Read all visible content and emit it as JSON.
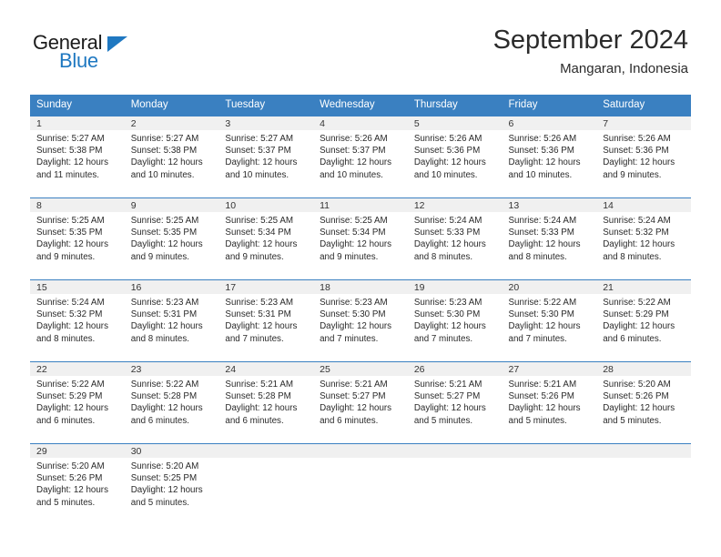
{
  "logo": {
    "primary_text": "General",
    "secondary_text": "Blue",
    "triangle_color": "#1f78c1"
  },
  "header": {
    "title": "September 2024",
    "subtitle": "Mangaran, Indonesia"
  },
  "theme": {
    "header_blue": "#3a80c1",
    "daynum_band": "#f0f0f0",
    "text": "#2a2a2a"
  },
  "calendar": {
    "weekday_headers": [
      "Sunday",
      "Monday",
      "Tuesday",
      "Wednesday",
      "Thursday",
      "Friday",
      "Saturday"
    ],
    "weeks": [
      [
        {
          "day": "1",
          "sunrise": "Sunrise: 5:27 AM",
          "sunset": "Sunset: 5:38 PM",
          "daylight_1": "Daylight: 12 hours",
          "daylight_2": "and 11 minutes."
        },
        {
          "day": "2",
          "sunrise": "Sunrise: 5:27 AM",
          "sunset": "Sunset: 5:38 PM",
          "daylight_1": "Daylight: 12 hours",
          "daylight_2": "and 10 minutes."
        },
        {
          "day": "3",
          "sunrise": "Sunrise: 5:27 AM",
          "sunset": "Sunset: 5:37 PM",
          "daylight_1": "Daylight: 12 hours",
          "daylight_2": "and 10 minutes."
        },
        {
          "day": "4",
          "sunrise": "Sunrise: 5:26 AM",
          "sunset": "Sunset: 5:37 PM",
          "daylight_1": "Daylight: 12 hours",
          "daylight_2": "and 10 minutes."
        },
        {
          "day": "5",
          "sunrise": "Sunrise: 5:26 AM",
          "sunset": "Sunset: 5:36 PM",
          "daylight_1": "Daylight: 12 hours",
          "daylight_2": "and 10 minutes."
        },
        {
          "day": "6",
          "sunrise": "Sunrise: 5:26 AM",
          "sunset": "Sunset: 5:36 PM",
          "daylight_1": "Daylight: 12 hours",
          "daylight_2": "and 10 minutes."
        },
        {
          "day": "7",
          "sunrise": "Sunrise: 5:26 AM",
          "sunset": "Sunset: 5:36 PM",
          "daylight_1": "Daylight: 12 hours",
          "daylight_2": "and 9 minutes."
        }
      ],
      [
        {
          "day": "8",
          "sunrise": "Sunrise: 5:25 AM",
          "sunset": "Sunset: 5:35 PM",
          "daylight_1": "Daylight: 12 hours",
          "daylight_2": "and 9 minutes."
        },
        {
          "day": "9",
          "sunrise": "Sunrise: 5:25 AM",
          "sunset": "Sunset: 5:35 PM",
          "daylight_1": "Daylight: 12 hours",
          "daylight_2": "and 9 minutes."
        },
        {
          "day": "10",
          "sunrise": "Sunrise: 5:25 AM",
          "sunset": "Sunset: 5:34 PM",
          "daylight_1": "Daylight: 12 hours",
          "daylight_2": "and 9 minutes."
        },
        {
          "day": "11",
          "sunrise": "Sunrise: 5:25 AM",
          "sunset": "Sunset: 5:34 PM",
          "daylight_1": "Daylight: 12 hours",
          "daylight_2": "and 9 minutes."
        },
        {
          "day": "12",
          "sunrise": "Sunrise: 5:24 AM",
          "sunset": "Sunset: 5:33 PM",
          "daylight_1": "Daylight: 12 hours",
          "daylight_2": "and 8 minutes."
        },
        {
          "day": "13",
          "sunrise": "Sunrise: 5:24 AM",
          "sunset": "Sunset: 5:33 PM",
          "daylight_1": "Daylight: 12 hours",
          "daylight_2": "and 8 minutes."
        },
        {
          "day": "14",
          "sunrise": "Sunrise: 5:24 AM",
          "sunset": "Sunset: 5:32 PM",
          "daylight_1": "Daylight: 12 hours",
          "daylight_2": "and 8 minutes."
        }
      ],
      [
        {
          "day": "15",
          "sunrise": "Sunrise: 5:24 AM",
          "sunset": "Sunset: 5:32 PM",
          "daylight_1": "Daylight: 12 hours",
          "daylight_2": "and 8 minutes."
        },
        {
          "day": "16",
          "sunrise": "Sunrise: 5:23 AM",
          "sunset": "Sunset: 5:31 PM",
          "daylight_1": "Daylight: 12 hours",
          "daylight_2": "and 8 minutes."
        },
        {
          "day": "17",
          "sunrise": "Sunrise: 5:23 AM",
          "sunset": "Sunset: 5:31 PM",
          "daylight_1": "Daylight: 12 hours",
          "daylight_2": "and 7 minutes."
        },
        {
          "day": "18",
          "sunrise": "Sunrise: 5:23 AM",
          "sunset": "Sunset: 5:30 PM",
          "daylight_1": "Daylight: 12 hours",
          "daylight_2": "and 7 minutes."
        },
        {
          "day": "19",
          "sunrise": "Sunrise: 5:23 AM",
          "sunset": "Sunset: 5:30 PM",
          "daylight_1": "Daylight: 12 hours",
          "daylight_2": "and 7 minutes."
        },
        {
          "day": "20",
          "sunrise": "Sunrise: 5:22 AM",
          "sunset": "Sunset: 5:30 PM",
          "daylight_1": "Daylight: 12 hours",
          "daylight_2": "and 7 minutes."
        },
        {
          "day": "21",
          "sunrise": "Sunrise: 5:22 AM",
          "sunset": "Sunset: 5:29 PM",
          "daylight_1": "Daylight: 12 hours",
          "daylight_2": "and 6 minutes."
        }
      ],
      [
        {
          "day": "22",
          "sunrise": "Sunrise: 5:22 AM",
          "sunset": "Sunset: 5:29 PM",
          "daylight_1": "Daylight: 12 hours",
          "daylight_2": "and 6 minutes."
        },
        {
          "day": "23",
          "sunrise": "Sunrise: 5:22 AM",
          "sunset": "Sunset: 5:28 PM",
          "daylight_1": "Daylight: 12 hours",
          "daylight_2": "and 6 minutes."
        },
        {
          "day": "24",
          "sunrise": "Sunrise: 5:21 AM",
          "sunset": "Sunset: 5:28 PM",
          "daylight_1": "Daylight: 12 hours",
          "daylight_2": "and 6 minutes."
        },
        {
          "day": "25",
          "sunrise": "Sunrise: 5:21 AM",
          "sunset": "Sunset: 5:27 PM",
          "daylight_1": "Daylight: 12 hours",
          "daylight_2": "and 6 minutes."
        },
        {
          "day": "26",
          "sunrise": "Sunrise: 5:21 AM",
          "sunset": "Sunset: 5:27 PM",
          "daylight_1": "Daylight: 12 hours",
          "daylight_2": "and 5 minutes."
        },
        {
          "day": "27",
          "sunrise": "Sunrise: 5:21 AM",
          "sunset": "Sunset: 5:26 PM",
          "daylight_1": "Daylight: 12 hours",
          "daylight_2": "and 5 minutes."
        },
        {
          "day": "28",
          "sunrise": "Sunrise: 5:20 AM",
          "sunset": "Sunset: 5:26 PM",
          "daylight_1": "Daylight: 12 hours",
          "daylight_2": "and 5 minutes."
        }
      ],
      [
        {
          "day": "29",
          "sunrise": "Sunrise: 5:20 AM",
          "sunset": "Sunset: 5:26 PM",
          "daylight_1": "Daylight: 12 hours",
          "daylight_2": "and 5 minutes."
        },
        {
          "day": "30",
          "sunrise": "Sunrise: 5:20 AM",
          "sunset": "Sunset: 5:25 PM",
          "daylight_1": "Daylight: 12 hours",
          "daylight_2": "and 5 minutes."
        },
        {
          "day": "",
          "sunrise": "",
          "sunset": "",
          "daylight_1": "",
          "daylight_2": ""
        },
        {
          "day": "",
          "sunrise": "",
          "sunset": "",
          "daylight_1": "",
          "daylight_2": ""
        },
        {
          "day": "",
          "sunrise": "",
          "sunset": "",
          "daylight_1": "",
          "daylight_2": ""
        },
        {
          "day": "",
          "sunrise": "",
          "sunset": "",
          "daylight_1": "",
          "daylight_2": ""
        },
        {
          "day": "",
          "sunrise": "",
          "sunset": "",
          "daylight_1": "",
          "daylight_2": ""
        }
      ]
    ]
  }
}
